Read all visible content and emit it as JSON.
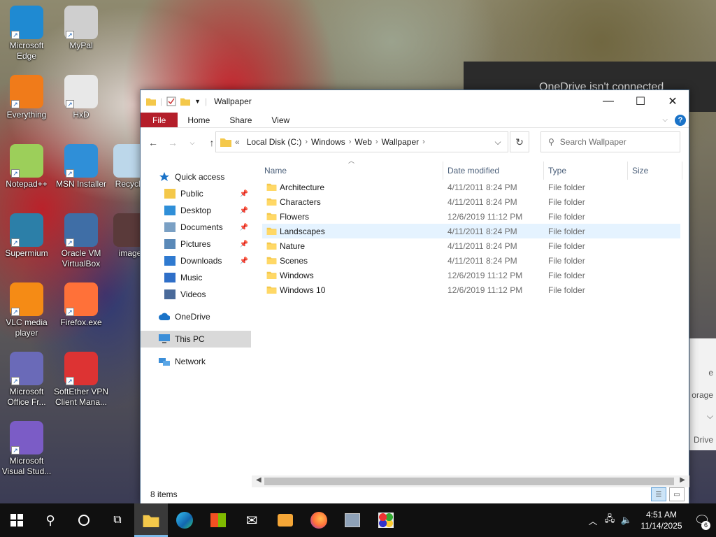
{
  "desktop": {
    "icons": [
      {
        "label": "Microsoft Edge",
        "icon": "edge-icon",
        "color": "#1f8ad2"
      },
      {
        "label": "MyPal",
        "icon": "mypal-icon",
        "color": "#cfcfcf"
      },
      {
        "label": "Everything",
        "icon": "everything-icon",
        "color": "#f07b1a"
      },
      {
        "label": "HxD",
        "icon": "hxd-icon",
        "color": "#e8e8e8"
      },
      {
        "label": "Notepad++",
        "icon": "notepadpp-icon",
        "color": "#9ccf5a"
      },
      {
        "label": "MSN Installer",
        "icon": "msn-icon",
        "color": "#2f8fd8"
      },
      {
        "label": "Recycle",
        "icon": "recycle-bin-icon",
        "color": "#bcd7ea"
      },
      {
        "label": "Supermium",
        "icon": "supermium-icon",
        "color": "#2c7fa8"
      },
      {
        "label": "Oracle VM VirtualBox",
        "icon": "virtualbox-icon",
        "color": "#3f6ea6"
      },
      {
        "label": "image",
        "icon": "image-icon",
        "color": "#5a3a3a"
      },
      {
        "label": "VLC media player",
        "icon": "vlc-icon",
        "color": "#f58b15"
      },
      {
        "label": "Firefox.exe",
        "icon": "firefox-icon",
        "color": "#ff7139"
      },
      {
        "label": "Microsoft Office Fr...",
        "icon": "office-icon",
        "color": "#6a6ab8"
      },
      {
        "label": "SoftEther VPN Client Mana...",
        "icon": "softether-icon",
        "color": "#d33"
      },
      {
        "label": "Microsoft Visual Stud...",
        "icon": "visual-studio-icon",
        "color": "#7b5cc6"
      }
    ]
  },
  "onedrive_popup": {
    "text": "OneDrive isn't connected"
  },
  "side_panel": {
    "frag1": "e",
    "frag2": "orage",
    "frag3": "Drive"
  },
  "window": {
    "title": "Wallpaper",
    "ribbon_tabs": [
      "File",
      "Home",
      "Share",
      "View"
    ],
    "address": {
      "prefix": "«",
      "crumbs": [
        "Local Disk (C:)",
        "Windows",
        "Web",
        "Wallpaper"
      ]
    },
    "search_placeholder": "Search Wallpaper",
    "nav_pane": {
      "quick_access": "Quick access",
      "items": [
        {
          "label": "Public",
          "icon": "folder-icon",
          "pinned": true
        },
        {
          "label": "Desktop",
          "icon": "desktop-icon",
          "pinned": true
        },
        {
          "label": "Documents",
          "icon": "documents-icon",
          "pinned": true
        },
        {
          "label": "Pictures",
          "icon": "pictures-icon",
          "pinned": true
        },
        {
          "label": "Downloads",
          "icon": "downloads-icon",
          "pinned": true
        },
        {
          "label": "Music",
          "icon": "music-icon",
          "pinned": false
        },
        {
          "label": "Videos",
          "icon": "videos-icon",
          "pinned": false
        }
      ],
      "onedrive": "OneDrive",
      "this_pc": "This PC",
      "network": "Network"
    },
    "columns": {
      "name": "Name",
      "date": "Date modified",
      "type": "Type",
      "size": "Size"
    },
    "files": [
      {
        "name": "Architecture",
        "date": "4/11/2011 8:24 PM",
        "type": "File folder"
      },
      {
        "name": "Characters",
        "date": "4/11/2011 8:24 PM",
        "type": "File folder"
      },
      {
        "name": "Flowers",
        "date": "12/6/2019 11:12 PM",
        "type": "File folder"
      },
      {
        "name": "Landscapes",
        "date": "4/11/2011 8:24 PM",
        "type": "File folder"
      },
      {
        "name": "Nature",
        "date": "4/11/2011 8:24 PM",
        "type": "File folder"
      },
      {
        "name": "Scenes",
        "date": "4/11/2011 8:24 PM",
        "type": "File folder"
      },
      {
        "name": "Windows",
        "date": "12/6/2019 11:12 PM",
        "type": "File folder"
      },
      {
        "name": "Windows 10",
        "date": "12/6/2019 11:12 PM",
        "type": "File folder"
      }
    ],
    "status": "8 items"
  },
  "taskbar": {
    "apps": [
      "start-icon",
      "search-icon",
      "cortana-icon",
      "task-view-icon",
      "file-explorer-icon",
      "edge-icon",
      "store-icon",
      "mail-icon",
      "media-icon",
      "firefox-icon",
      "virtualbox-icon",
      "softether-icon"
    ],
    "time": "4:51 AM",
    "date": "11/14/2025",
    "notification_count": "6"
  },
  "colors": {
    "file_tab": "#b41e2a",
    "folder": "#f4c84a",
    "accent": "#0078d7"
  }
}
